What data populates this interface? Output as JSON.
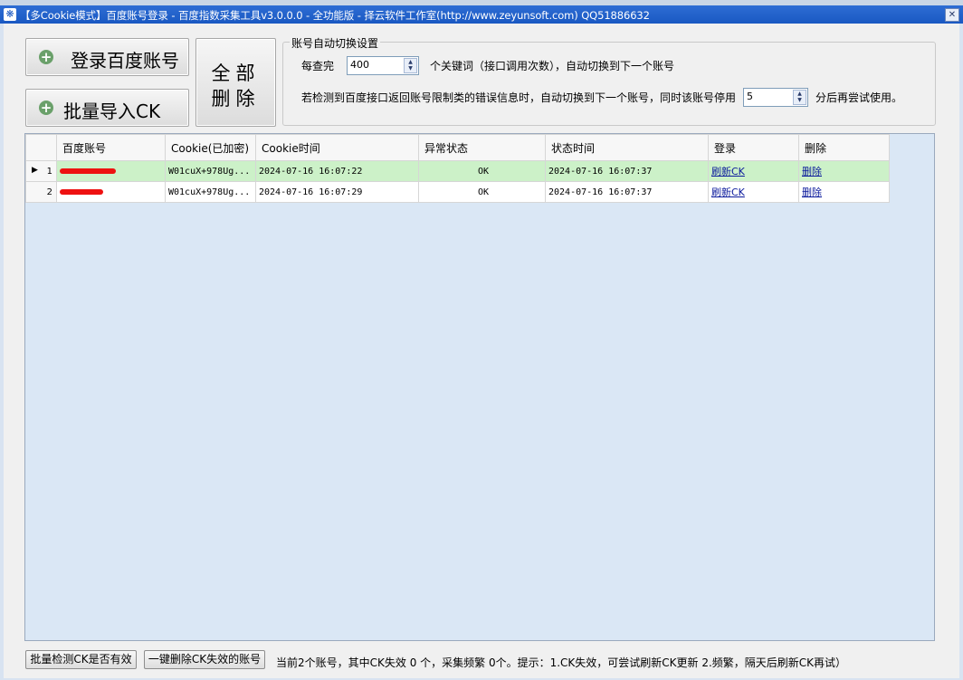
{
  "window": {
    "title": "【多Cookie模式】百度账号登录 - 百度指数采集工具v3.0.0.0 - 全功能版 - 择云软件工作室(http://www.zeyunsoft.com) QQ51886632",
    "close_glyph": "✕",
    "app_icon": "paw-icon"
  },
  "buttons": {
    "login": "登录百度账号",
    "import_ck": "批量导入CK",
    "delete_all_line1": "全部",
    "delete_all_line2": "删除",
    "check_ck": "批量检测CK是否有效",
    "delete_invalid": "一键删除CK失效的账号"
  },
  "settings": {
    "group_title": "账号自动切换设置",
    "per_query_label": "每查完",
    "per_query_value": "400",
    "per_query_suffix": "个关键词（接口调用次数），自动切换到下一个账号",
    "error_prefix": "若检测到百度接口返回账号限制类的错误信息时，自动切换到下一个账号，同时该账号停用",
    "error_value": "5",
    "error_suffix": "分后再尝试使用。"
  },
  "table": {
    "columns": [
      "百度账号",
      "Cookie(已加密)",
      "Cookie时间",
      "异常状态",
      "状态时间",
      "登录",
      "删除"
    ],
    "rows": [
      {
        "index": "1",
        "cookie": "W01cuX+978Ug...",
        "cookie_time": "2024-07-16 16:07:22",
        "status": "OK",
        "status_time": "2024-07-16 16:07:37",
        "login_link": "刷新CK",
        "delete_link": "删除"
      },
      {
        "index": "2",
        "cookie": "W01cuX+978Ug...",
        "cookie_time": "2024-07-16 16:07:29",
        "status": "OK",
        "status_time": "2024-07-16 16:07:37",
        "login_link": "刷新CK",
        "delete_link": "删除"
      }
    ]
  },
  "status_bar": "当前2个账号，其中CK失效 0 个，采集频繁 0个。提示：1.CK失效，可尝试刷新CK更新 2.频繁，隔天后刷新CK再试）",
  "colors": {
    "title_bar": "#1a58c2",
    "selected_row": "#ccf1c8",
    "grid_bg": "#dae7f5",
    "link": "#0b1a9c",
    "redaction": "#ee1111"
  }
}
